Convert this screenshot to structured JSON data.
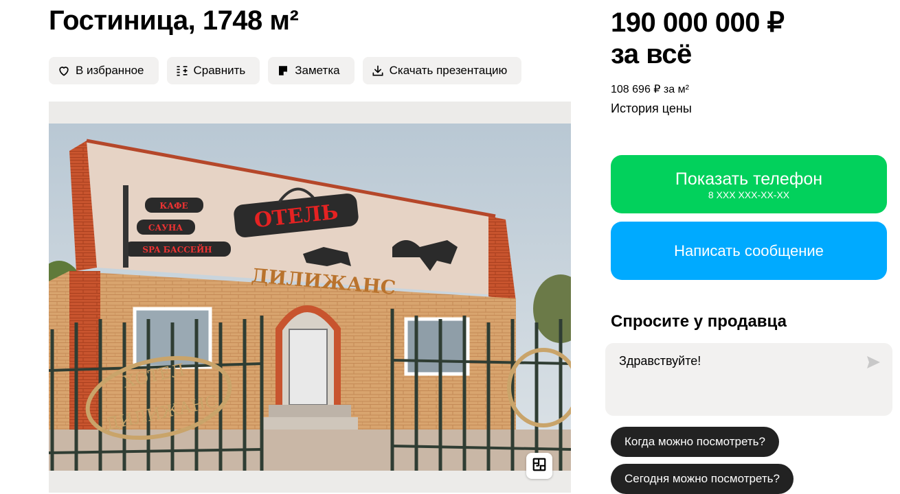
{
  "listing": {
    "title": "Гостиница, 1748 м²"
  },
  "actions": {
    "favorite": "В избранное",
    "compare": "Сравнить",
    "note": "Заметка",
    "download": "Скачать презентацию"
  },
  "price": {
    "line1": "190 000 000 ₽",
    "line2": "за всё",
    "per_m2": "108 696 ₽ за м²",
    "history": "История цены"
  },
  "contact": {
    "show_phone": "Показать телефон",
    "phone_mask": "8 XXX XXX-XX-XX",
    "write_message": "Написать сообщение"
  },
  "ask": {
    "title": "Спросите у продавца",
    "message_value": "Здравствуйте!",
    "suggestions": [
      "Когда можно посмотреть?",
      "Сегодня можно посмотреть?"
    ]
  },
  "photo": {
    "signs": [
      "КАФЕ",
      "САУНА",
      "SPA БАССЕЙН",
      "ОТЕЛЬ",
      "ДИЛИЖАНС",
      "ХОТЕЛ ДИЛИЖАНС"
    ]
  },
  "colors": {
    "green": "#02d15c",
    "blue": "#00aaff",
    "chip_bg": "#222222",
    "button_bg": "#f2f1f0"
  },
  "icons": [
    "heart-icon",
    "compare-icon",
    "note-icon",
    "download-icon",
    "floor-plan-icon",
    "send-icon"
  ]
}
